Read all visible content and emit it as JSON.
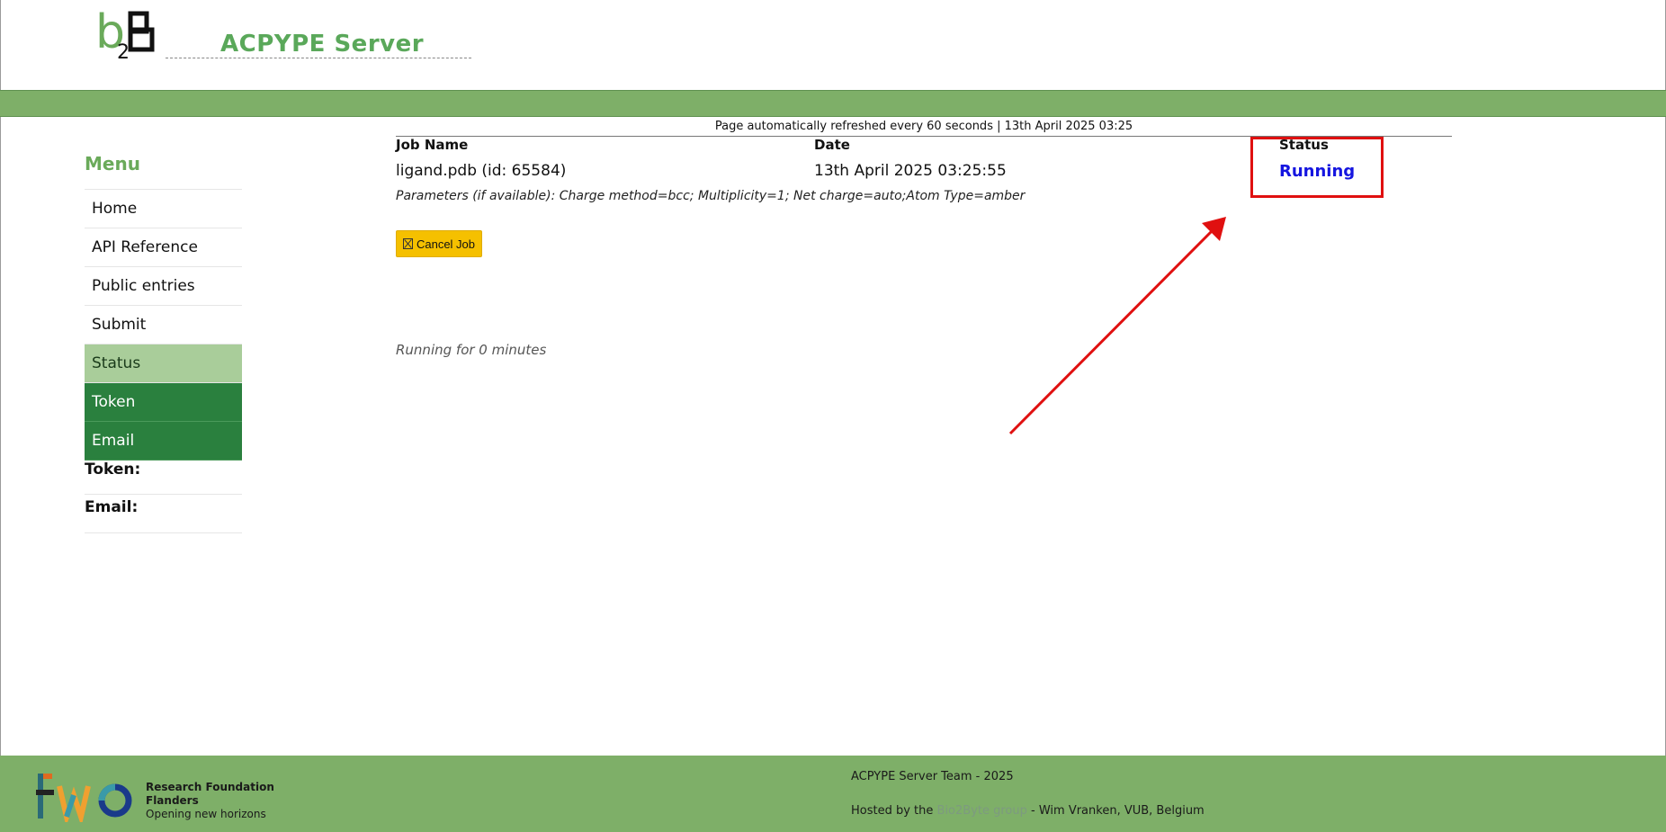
{
  "header": {
    "logo_b": "b",
    "logo_sub": "2",
    "site_title": "ACPYPE Server"
  },
  "sidebar": {
    "menu_title": "Menu",
    "items": [
      {
        "label": "Home"
      },
      {
        "label": "API Reference"
      },
      {
        "label": "Public entries"
      },
      {
        "label": "Submit"
      },
      {
        "label": "Status"
      },
      {
        "label": "Token"
      },
      {
        "label": "Email"
      }
    ],
    "token_label": "Token:",
    "email_label": "Email:"
  },
  "main": {
    "refresh_note": "Page automatically refreshed every 60 seconds | 13th April 2025 03:25",
    "columns": {
      "job_name": "Job Name",
      "date": "Date",
      "status": "Status"
    },
    "job": {
      "name": "ligand.pdb (id: 65584)",
      "date": "13th April 2025 03:25:55",
      "status": "Running"
    },
    "params": "Parameters (if available): Charge method=bcc; Multiplicity=1; Net charge=auto;Atom Type=amber",
    "cancel_label": "Cancel Job",
    "running_for": "Running for 0 minutes"
  },
  "annotation": {
    "color": "#e01010"
  },
  "footer": {
    "fwo_line1": "Research Foundation",
    "fwo_line2": "Flanders",
    "fwo_line3": "Opening new horizons",
    "team": "ACPYPE Server Team - 2025",
    "hosted_prefix": "Hosted by the ",
    "hosted_link": "Bio2Byte group",
    "hosted_suffix": " - Wim Vranken, VUB, Belgium"
  },
  "colors": {
    "green_bar": "#7eaf68",
    "menu_active": "#a9cd9a",
    "menu_dark": "#2a803e",
    "status_running": "#1515e0",
    "cancel_button": "#f5c000"
  }
}
